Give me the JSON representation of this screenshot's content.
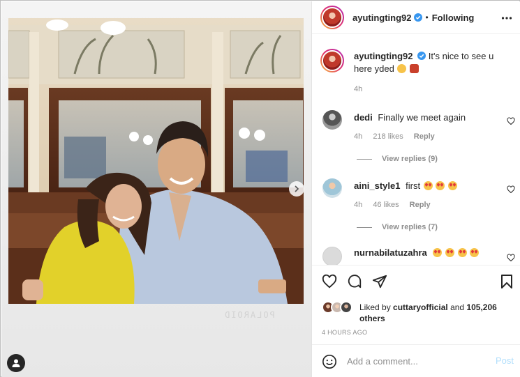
{
  "post": {
    "username": "ayutingting92",
    "follow_separator": "•",
    "follow_status": "Following",
    "polaroid_label": "POLAROID"
  },
  "caption": {
    "username": "ayutingting92",
    "text": "It's nice to see u here yded",
    "time": "4h"
  },
  "comments": [
    {
      "username": "dedi",
      "text": "Finally we meet again",
      "time": "4h",
      "likes": "218 likes",
      "reply": "Reply",
      "view_replies": "View replies (9)"
    },
    {
      "username": "aini_style1",
      "text": "first",
      "time": "4h",
      "likes": "46 likes",
      "reply": "Reply",
      "view_replies": "View replies (7)"
    },
    {
      "username": "nurnabilatuzahra",
      "text": ""
    }
  ],
  "liked_by": {
    "prefix": "Liked by",
    "user": "cuttaryofficial",
    "and": "and",
    "count": "105,206 others"
  },
  "timestamp": "4 HOURS AGO",
  "add_comment": {
    "placeholder": "Add a comment...",
    "post_label": "Post"
  },
  "colors": {
    "verified": "#3897f0",
    "post_disabled": "#b2dffc",
    "muted": "#8e8e8e"
  },
  "icons": [
    "verified-icon",
    "more-icon",
    "heart-icon",
    "comment-icon",
    "share-icon",
    "bookmark-icon",
    "smile-icon",
    "chevron-right-icon",
    "user-tag-icon"
  ]
}
